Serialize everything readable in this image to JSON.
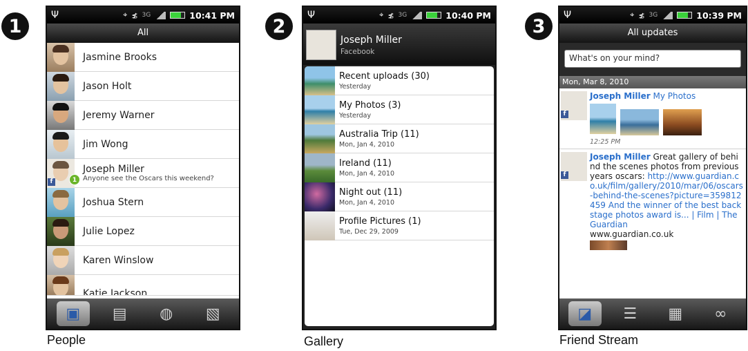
{
  "panels": [
    {
      "number": "1",
      "caption": "People"
    },
    {
      "number": "2",
      "caption": "Gallery"
    },
    {
      "number": "3",
      "caption": "Friend Stream"
    }
  ],
  "status": {
    "usb": "Ψ",
    "network": "3G",
    "times": [
      "10:41 PM",
      "10:40 PM",
      "10:39 PM"
    ]
  },
  "people": {
    "title": "All",
    "contacts": [
      {
        "name": "Jasmine  Brooks"
      },
      {
        "name": "Jason  Holt"
      },
      {
        "name": "Jeremy Warner"
      },
      {
        "name": "Jim Wong"
      },
      {
        "name": "Joseph Miller",
        "status": "Anyone see the Oscars this weekend?",
        "badge": "1",
        "source": "f"
      },
      {
        "name": "Joshua Stern"
      },
      {
        "name": "Julie Lopez"
      },
      {
        "name": "Karen  Winslow"
      },
      {
        "name": "Katie  Jackson"
      }
    ]
  },
  "gallery": {
    "name": "Joseph Miller",
    "source": "Facebook",
    "albums": [
      {
        "title": "Recent uploads  (30)",
        "date": "Yesterday"
      },
      {
        "title": "My Photos  (3)",
        "date": "Yesterday"
      },
      {
        "title": "Australia Trip  (11)",
        "date": "Mon, Jan 4, 2010"
      },
      {
        "title": "Ireland  (11)",
        "date": "Mon, Jan 4, 2010"
      },
      {
        "title": "Night out  (11)",
        "date": "Mon, Jan 4, 2010"
      },
      {
        "title": "Profile Pictures  (1)",
        "date": "Tue, Dec 29, 2009"
      }
    ]
  },
  "stream": {
    "title": "All updates",
    "input_placeholder": "What's on your mind?",
    "date_header": "Mon, Mar 8, 2010",
    "post1": {
      "author": "Joseph Miller",
      "link": "My Photos",
      "time": "12:25 PM"
    },
    "post2": {
      "author": "Joseph Miller",
      "text": "Great gallery of behind the scenes photos from previous years oscars:",
      "url": "http://www.guardian.co.uk/film/gallery/2010/mar/06/oscars-behind-the-scenes?picture=359812459",
      "link_title": "And the winner of the best backstage photos award is... | Film | The Guardian",
      "domain": "www.guardian.co.uk"
    }
  },
  "colors": {
    "accent": "#2a6fcb",
    "facebook": "#3b5998",
    "badge": "#6bb52a"
  },
  "icons": {
    "people_tabs": [
      "contacts-card-icon",
      "groups-card-icon",
      "online-directory-icon",
      "call-history-icon"
    ],
    "stream_tabs": [
      "all-updates-icon",
      "status-updates-icon",
      "photos-icon",
      "links-icon"
    ]
  }
}
